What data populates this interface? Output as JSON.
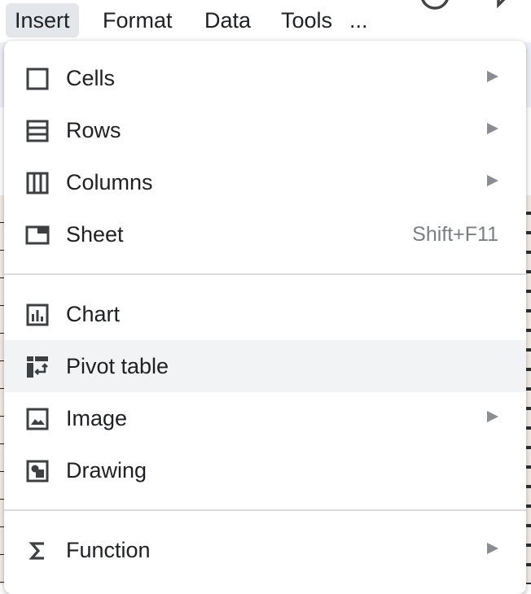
{
  "menubar": {
    "items": [
      {
        "label": "Insert",
        "active": true
      },
      {
        "label": "Format",
        "active": false
      },
      {
        "label": "Data",
        "active": false
      },
      {
        "label": "Tools",
        "active": false
      },
      {
        "label": "...",
        "active": false
      }
    ]
  },
  "menu": {
    "items": [
      {
        "label": "Cells",
        "icon": "cells-icon",
        "submenu": true
      },
      {
        "label": "Rows",
        "icon": "rows-icon",
        "submenu": true
      },
      {
        "label": "Columns",
        "icon": "columns-icon",
        "submenu": true
      },
      {
        "label": "Sheet",
        "icon": "sheet-icon",
        "shortcut": "Shift+F11"
      },
      {
        "label": "Chart",
        "icon": "chart-icon"
      },
      {
        "label": "Pivot table",
        "icon": "pivot-table-icon",
        "highlighted": true
      },
      {
        "label": "Image",
        "icon": "image-icon",
        "submenu": true
      },
      {
        "label": "Drawing",
        "icon": "drawing-icon"
      },
      {
        "label": "Function",
        "icon": "sigma-icon",
        "submenu": true
      }
    ]
  },
  "colors": {
    "active_menubar_bg": "#e3e6ea",
    "hover_bg": "#f1f3f4",
    "text": "#202124",
    "muted": "#7b7f83"
  }
}
